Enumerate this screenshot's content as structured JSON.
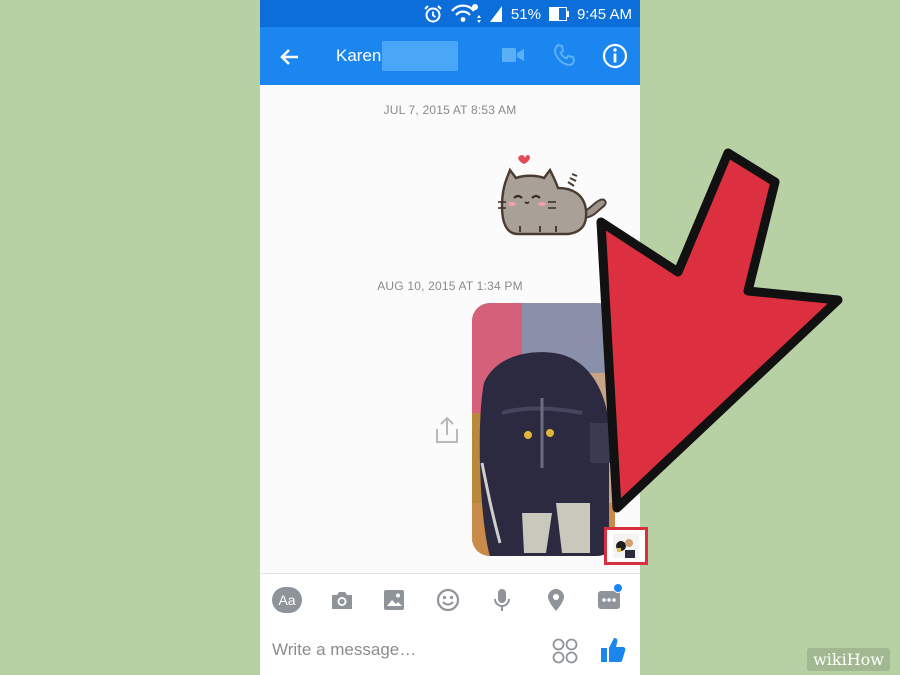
{
  "status_bar": {
    "battery": "51%",
    "time": "9:45 AM"
  },
  "header": {
    "contact_name": "Karen",
    "icons": [
      "back-arrow-icon",
      "video-call-icon",
      "phone-icon",
      "info-icon"
    ]
  },
  "conversation": {
    "timestamps": [
      "JUL 7, 2015 AT 8:53 AM",
      "AUG 10, 2015 AT 1:34 PM"
    ]
  },
  "composer": {
    "tools": [
      "Aa",
      "camera-icon",
      "gallery-icon",
      "emoji-icon",
      "microphone-icon",
      "location-icon",
      "more-icon"
    ],
    "placeholder": "Write a message…"
  },
  "watermark": "wikiHow",
  "colors": {
    "accent": "#1b86f0",
    "arrow": "#d8303e",
    "background": "#b7d0a4"
  }
}
